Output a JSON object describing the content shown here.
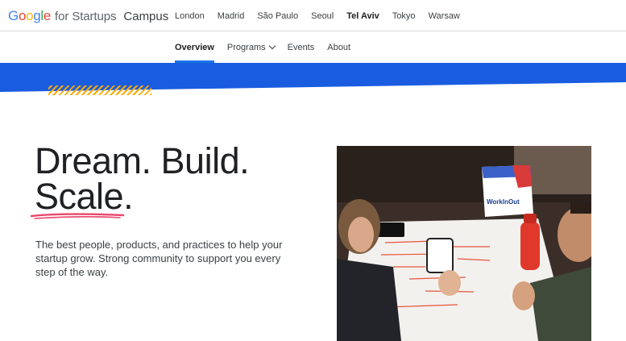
{
  "header": {
    "logo_text": "Google",
    "brand_suffix": "for Startups",
    "campus_label": "Campus",
    "cities": [
      {
        "label": "London",
        "active": false
      },
      {
        "label": "Madrid",
        "active": false
      },
      {
        "label": "São Paulo",
        "active": false
      },
      {
        "label": "Seoul",
        "active": false
      },
      {
        "label": "Tel Aviv",
        "active": true
      },
      {
        "label": "Tokyo",
        "active": false
      },
      {
        "label": "Warsaw",
        "active": false
      }
    ]
  },
  "subnav": {
    "overview": "Overview",
    "programs": "Programs",
    "events": "Events",
    "about": "About"
  },
  "hero": {
    "headline_line1": "Dream. Build.",
    "headline_line2": "Scale.",
    "description": "The best people, products, and practices to help your startup grow. Strong community to support you every step of the way."
  },
  "photo": {
    "sign_text": "WorkInOut"
  },
  "colors": {
    "accent_blue": "#1a73e8",
    "band_blue": "#1a5ce0",
    "hatch_yellow": "#f9ab00",
    "underline_pink": "#e8476b"
  }
}
